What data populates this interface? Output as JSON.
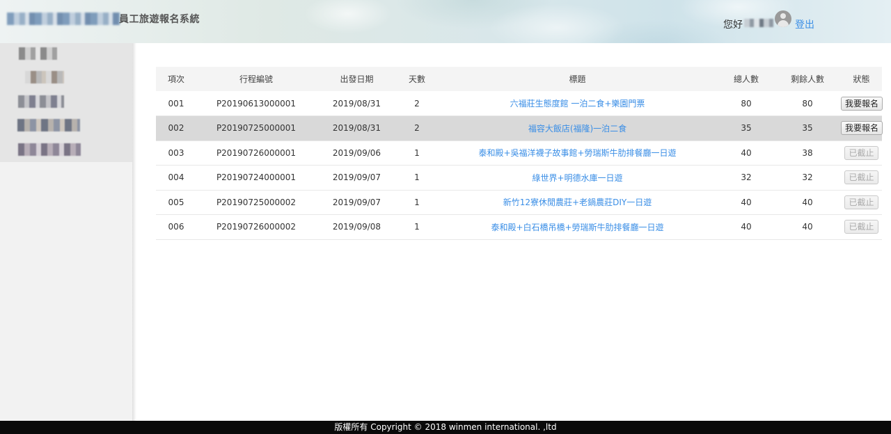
{
  "header": {
    "system_title": "員工旅遊報名系統",
    "greeting": "您好",
    "logout_label": "登出"
  },
  "table": {
    "columns": [
      "項次",
      "行程編號",
      "出發日期",
      "天數",
      "標題",
      "總人數",
      "剩餘人數",
      "狀態"
    ],
    "rows": [
      {
        "no": "001",
        "code": "P20190613000001",
        "date": "2019/08/31",
        "days": "2",
        "title": "六福莊生態度館 一泊二食+樂園門票",
        "total": "80",
        "remaining": "80",
        "status": "我要報名"
      },
      {
        "no": "002",
        "code": "P20190725000001",
        "date": "2019/08/31",
        "days": "2",
        "title": "福容大飯店(福隆)一泊二食",
        "total": "35",
        "remaining": "35",
        "status": "我要報名"
      },
      {
        "no": "003",
        "code": "P20190726000001",
        "date": "2019/09/06",
        "days": "1",
        "title": "泰和殿+吳福洋襪子故事館+勞瑞斯牛肋排餐廳一日遊",
        "total": "40",
        "remaining": "38",
        "status": "已截止"
      },
      {
        "no": "004",
        "code": "P20190724000001",
        "date": "2019/09/07",
        "days": "1",
        "title": "綠世界+明德水庫一日遊",
        "total": "32",
        "remaining": "32",
        "status": "已截止"
      },
      {
        "no": "005",
        "code": "P20190725000002",
        "date": "2019/09/07",
        "days": "1",
        "title": "新竹12寮休閒農莊+老鍋農莊DIY一日遊",
        "total": "40",
        "remaining": "40",
        "status": "已截止"
      },
      {
        "no": "006",
        "code": "P20190726000002",
        "date": "2019/09/08",
        "days": "1",
        "title": "泰和殿+白石橋吊橋+勞瑞斯牛肋排餐廳一日遊",
        "total": "40",
        "remaining": "40",
        "status": "已截止"
      }
    ]
  },
  "footer": {
    "copyright": "版權所有 Copyright © 2018 winmen international. ,ltd"
  },
  "colors": {
    "link": "#3a8ee6",
    "selected_row": "#d9d9d9",
    "footer_bg": "#0a0a0a"
  }
}
